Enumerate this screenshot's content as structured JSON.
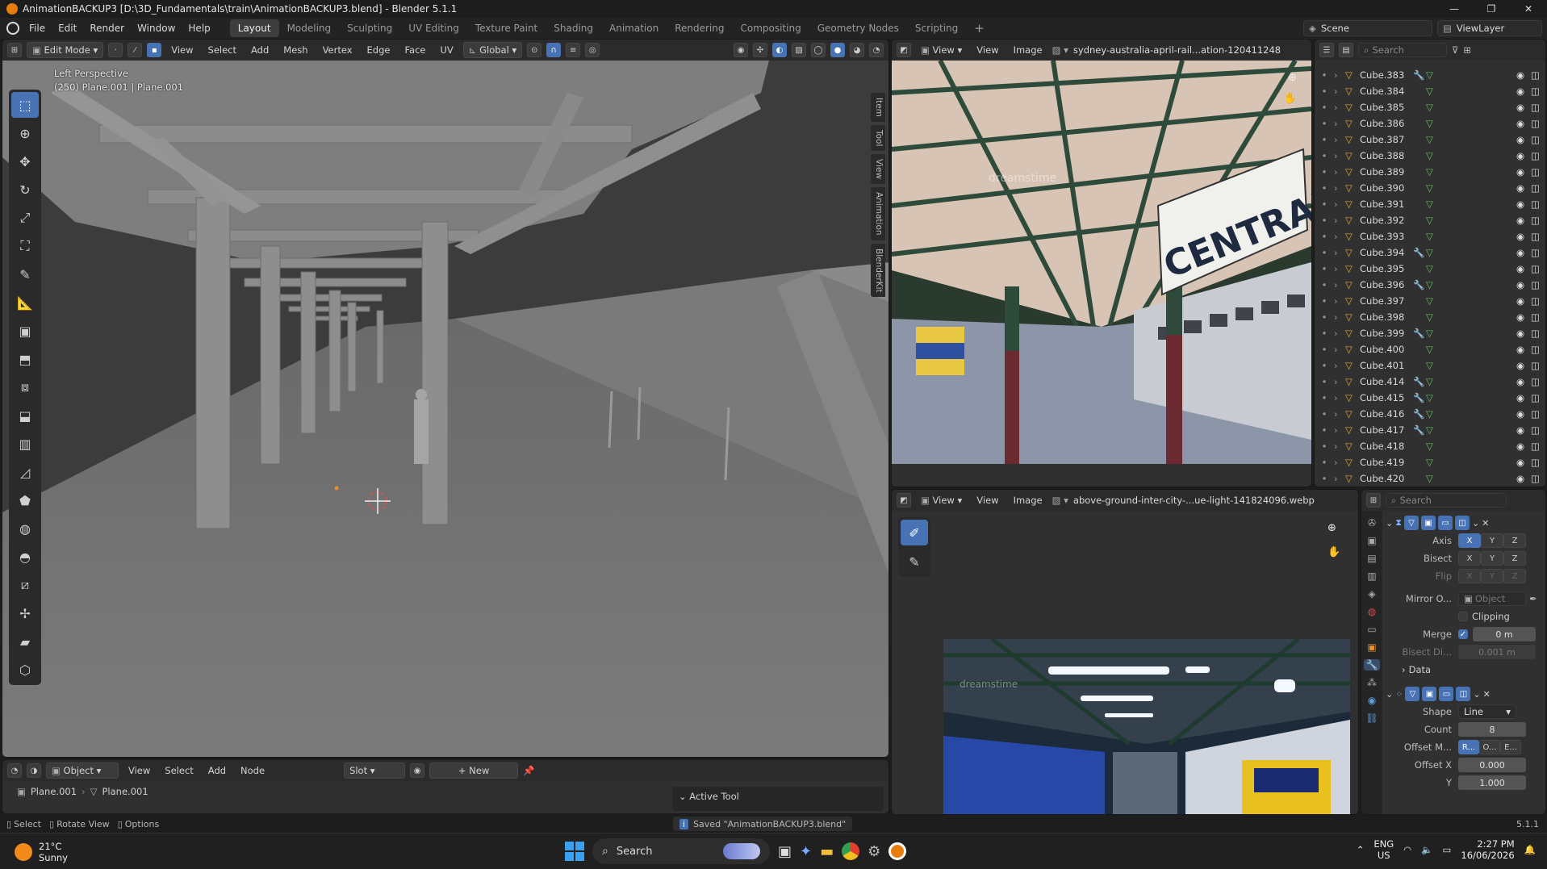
{
  "window": {
    "title": "AnimationBACKUP3 [D:\\3D_Fundamentals\\train\\AnimationBACKUP3.blend] - Blender 5.1.1",
    "controls": [
      "—",
      "❐",
      "✕"
    ]
  },
  "menubar": {
    "menus": [
      "File",
      "Edit",
      "Render",
      "Window",
      "Help"
    ],
    "workspaces": [
      "Layout",
      "Modeling",
      "Sculpting",
      "UV Editing",
      "Texture Paint",
      "Shading",
      "Animation",
      "Rendering",
      "Compositing",
      "Geometry Nodes",
      "Scripting"
    ],
    "active_workspace": "Layout",
    "add_tab": "+",
    "scene": "Scene",
    "view_layer": "ViewLayer"
  },
  "viewport": {
    "mode": "Edit Mode",
    "menus": [
      "View",
      "Select",
      "Add",
      "Mesh",
      "Vertex",
      "Edge",
      "Face",
      "UV"
    ],
    "transform_orientation": "Global",
    "overlay_title": "Left Perspective",
    "overlay_sub": "(250) Plane.001 | Plane.001",
    "side_tabs": [
      "Item",
      "Tool",
      "View",
      "Animation",
      "BlenderKit"
    ]
  },
  "image_editor_top": {
    "menus": [
      "View",
      "View",
      "Image"
    ],
    "image_name": "sydney-australia-april-rail...ation-120411248",
    "sign_text": "CENTRAL",
    "watermark": "dreamstime"
  },
  "image_editor_bottom": {
    "menus": [
      "View",
      "View",
      "Image"
    ],
    "image_name": "above-ground-inter-city-...ue-light-141824096.webp",
    "watermark": "dreamstime"
  },
  "outliner": {
    "search_placeholder": "Search",
    "items": [
      {
        "name": "Cube.383",
        "mod": true
      },
      {
        "name": "Cube.384",
        "mod": false
      },
      {
        "name": "Cube.385",
        "mod": false
      },
      {
        "name": "Cube.386",
        "mod": false
      },
      {
        "name": "Cube.387",
        "mod": false
      },
      {
        "name": "Cube.388",
        "mod": false
      },
      {
        "name": "Cube.389",
        "mod": false
      },
      {
        "name": "Cube.390",
        "mod": false
      },
      {
        "name": "Cube.391",
        "mod": false
      },
      {
        "name": "Cube.392",
        "mod": false
      },
      {
        "name": "Cube.393",
        "mod": false
      },
      {
        "name": "Cube.394",
        "mod": true
      },
      {
        "name": "Cube.395",
        "mod": false
      },
      {
        "name": "Cube.396",
        "mod": true
      },
      {
        "name": "Cube.397",
        "mod": false
      },
      {
        "name": "Cube.398",
        "mod": false
      },
      {
        "name": "Cube.399",
        "mod": true
      },
      {
        "name": "Cube.400",
        "mod": false
      },
      {
        "name": "Cube.401",
        "mod": false
      },
      {
        "name": "Cube.414",
        "mod": true
      },
      {
        "name": "Cube.415",
        "mod": true
      },
      {
        "name": "Cube.416",
        "mod": true
      },
      {
        "name": "Cube.417",
        "mod": true
      },
      {
        "name": "Cube.418",
        "mod": false
      },
      {
        "name": "Cube.419",
        "mod": false
      },
      {
        "name": "Cube.420",
        "mod": false
      }
    ]
  },
  "properties": {
    "search_placeholder": "Search",
    "mirror": {
      "axis_label": "Axis",
      "bisect_label": "Bisect",
      "flip_label": "Flip",
      "xyz": [
        "X",
        "Y",
        "Z"
      ],
      "mirror_object_label": "Mirror O...",
      "mirror_object_placeholder": "Object",
      "clipping_label": "Clipping",
      "merge_label": "Merge",
      "merge_value": "0 m",
      "bisect_dist_label": "Bisect Di...",
      "bisect_dist_value": "0.001 m",
      "data_label": "Data"
    },
    "array": {
      "shape_label": "Shape",
      "shape_value": "Line",
      "count_label": "Count",
      "count_value": "8",
      "offset_mode_label": "Offset M...",
      "offset_modes": [
        "R...",
        "O...",
        "E..."
      ],
      "offset_x_label": "Offset X",
      "offset_x_value": "0.000",
      "offset_y_label": "Y",
      "offset_y_value": "1.000"
    }
  },
  "shader_editor": {
    "object_mode": "Object",
    "menus": [
      "View",
      "Select",
      "Add",
      "Node"
    ],
    "slot": "Slot",
    "new_button": "New",
    "breadcrumb_1": "Plane.001",
    "breadcrumb_2": "Plane.001",
    "active_tool_label": "Active Tool"
  },
  "statusbar": {
    "select": "Select",
    "rotate": "Rotate View",
    "options": "Options",
    "saved_message": "Saved \"AnimationBACKUP3.blend\"",
    "version": "5.1.1"
  },
  "taskbar": {
    "weather_temp": "21°C",
    "weather_desc": "Sunny",
    "search": "Search",
    "lang": "ENG",
    "region": "US",
    "time": "2:27 PM",
    "date": "16/06/2026"
  },
  "colors": {
    "accent": "#4772b3",
    "blender_orange": "#e87d0d",
    "mesh_icon": "#e8a33c",
    "modifier_icon": "#7fb5ff",
    "data_icon": "#60c060"
  }
}
